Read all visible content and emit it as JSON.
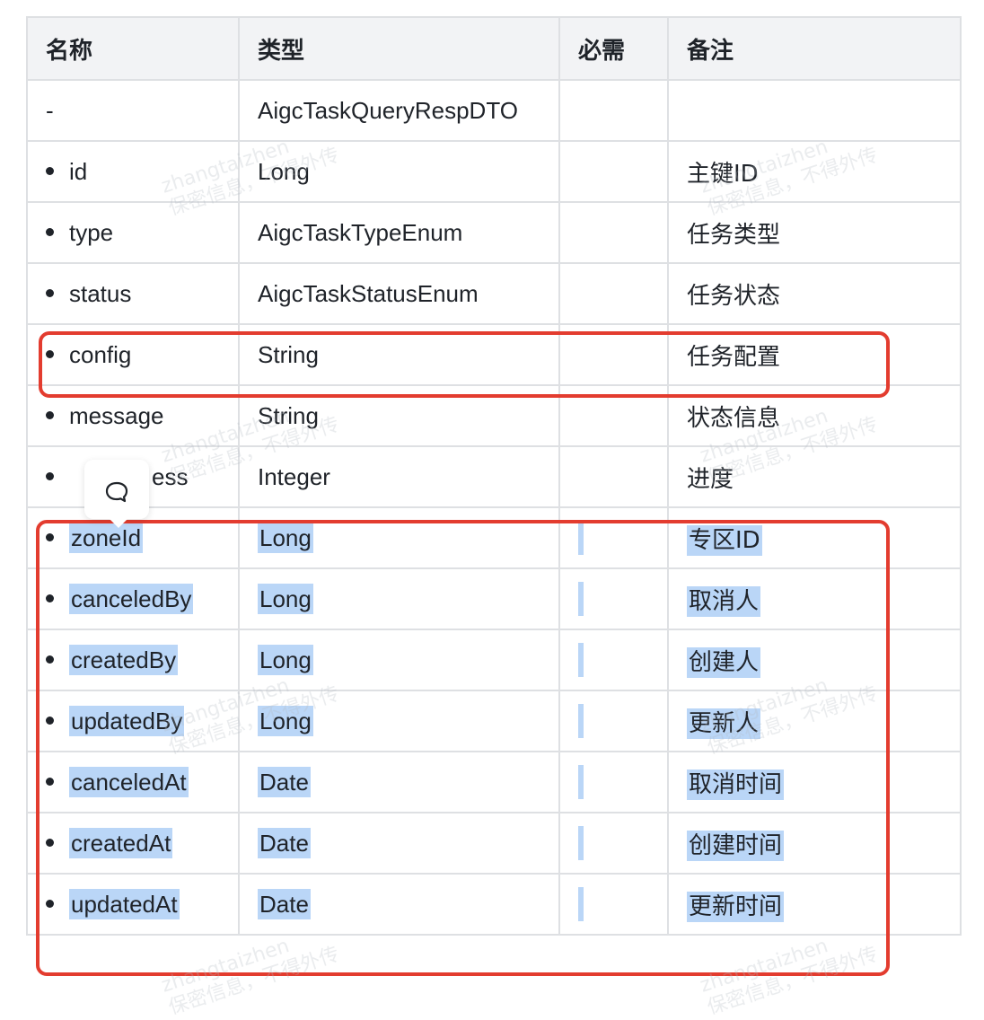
{
  "table": {
    "headers": {
      "name": "名称",
      "type": "类型",
      "required": "必需",
      "note": "备注"
    },
    "rows": [
      {
        "name": "-",
        "type": "AigcTaskQueryRespDTO",
        "required": "",
        "note": ""
      },
      {
        "name": "id",
        "type": "Long",
        "required": "",
        "note": "主键ID"
      },
      {
        "name": "type",
        "type": "AigcTaskTypeEnum",
        "required": "",
        "note": "任务类型"
      },
      {
        "name": "status",
        "type": "AigcTaskStatusEnum",
        "required": "",
        "note": "任务状态"
      },
      {
        "name": "config",
        "type": "String",
        "required": "",
        "note": "任务配置"
      },
      {
        "name": "message",
        "type": "String",
        "required": "",
        "note": "状态信息"
      },
      {
        "name": "ess",
        "type": "Integer",
        "required": "",
        "note": "进度"
      },
      {
        "name": "zoneId",
        "type": "Long",
        "required": "",
        "note": "专区ID"
      },
      {
        "name": "canceledBy",
        "type": "Long",
        "required": "",
        "note": "取消人"
      },
      {
        "name": "createdBy",
        "type": "Long",
        "required": "",
        "note": "创建人"
      },
      {
        "name": "updatedBy",
        "type": "Long",
        "required": "",
        "note": "更新人"
      },
      {
        "name": "canceledAt",
        "type": "Date",
        "required": "",
        "note": "取消时间"
      },
      {
        "name": "createdAt",
        "type": "Date",
        "required": "",
        "note": "创建时间"
      },
      {
        "name": "updatedAt",
        "type": "Date",
        "required": "",
        "note": "更新时间"
      }
    ]
  },
  "watermark": {
    "user": "zhangtaizhen",
    "notice": "保密信息，不得外传"
  },
  "icons": {
    "comment": "comment-icon"
  },
  "colors": {
    "highlight": "#bad6f7",
    "annotation": "#e33c2f",
    "header_bg": "#f2f3f5",
    "border": "#dee0e3"
  }
}
